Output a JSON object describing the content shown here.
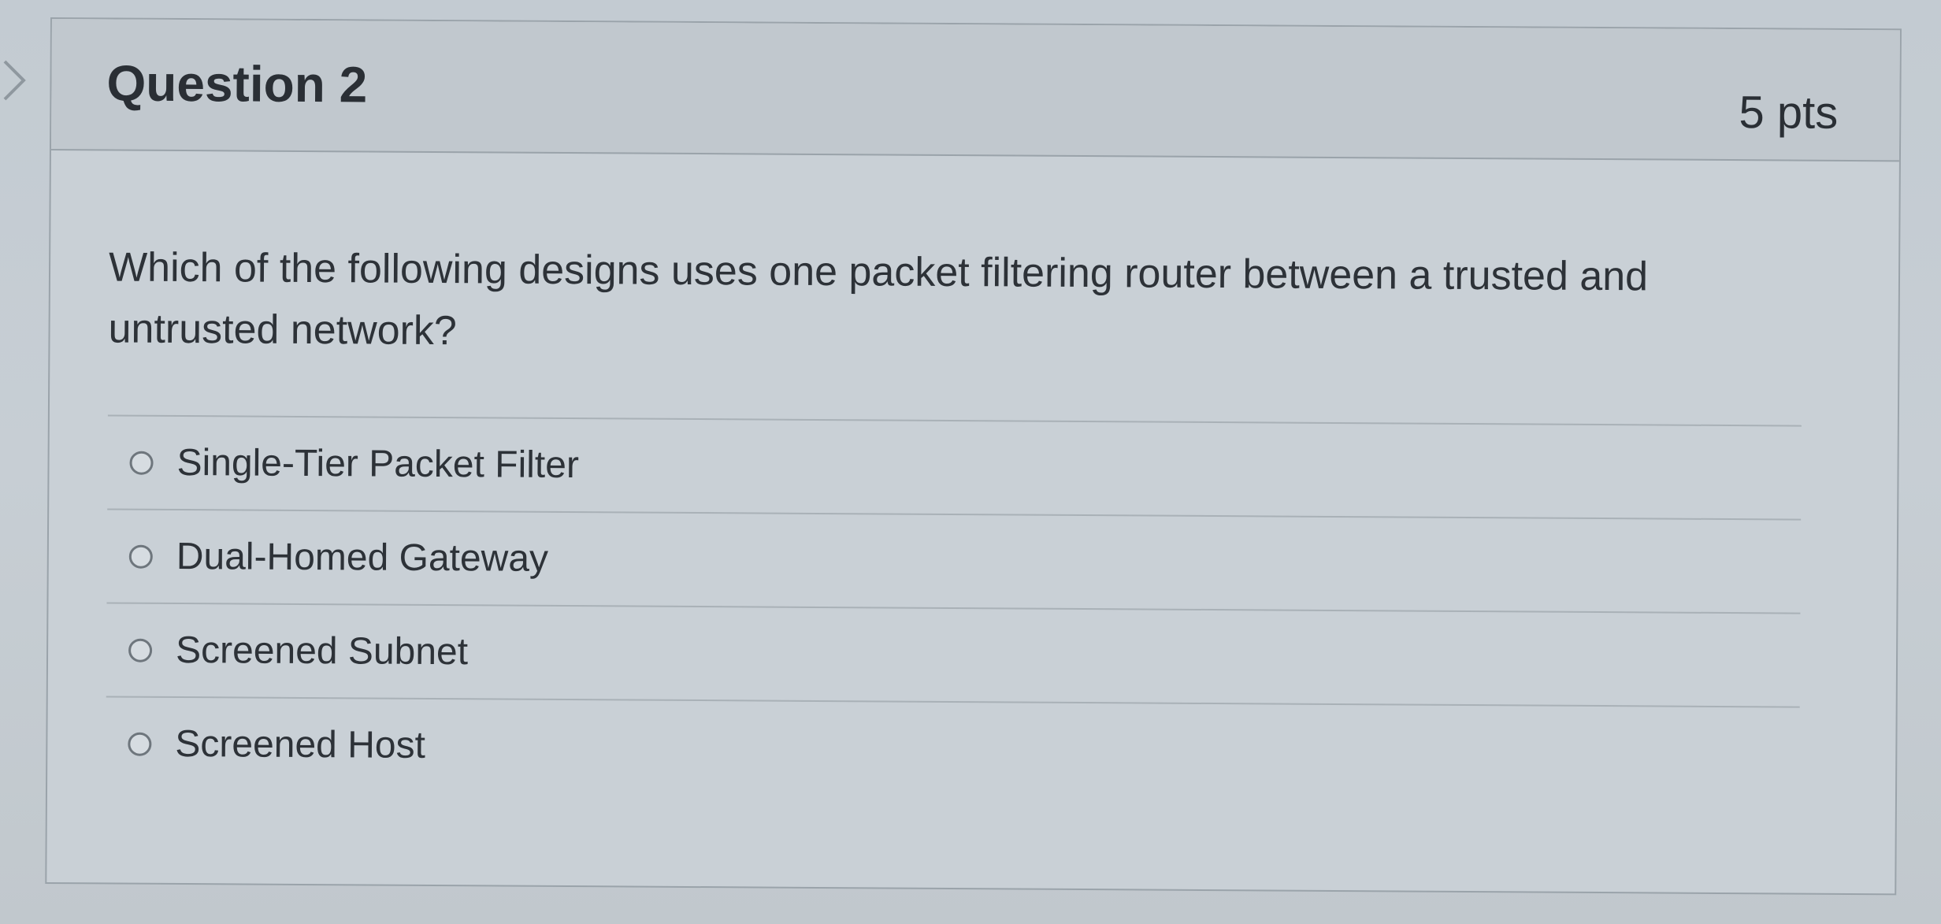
{
  "question": {
    "title": "Question 2",
    "points": "5 pts",
    "text": "Which of the following designs uses one packet filtering router between a trusted and untrusted network?",
    "answers": [
      {
        "label": "Single-Tier Packet Filter",
        "selected": false
      },
      {
        "label": "Dual-Homed Gateway",
        "selected": false
      },
      {
        "label": "Screened Subnet",
        "selected": false
      },
      {
        "label": "Screened Host",
        "selected": false
      }
    ]
  },
  "icons": {
    "nav": "chevron-right-icon",
    "radio": "radio-unchecked-icon"
  },
  "colors": {
    "background": "#c5ccd2",
    "header": "#c1c8ce",
    "border": "#9aa3aa",
    "text": "#2b3036"
  }
}
